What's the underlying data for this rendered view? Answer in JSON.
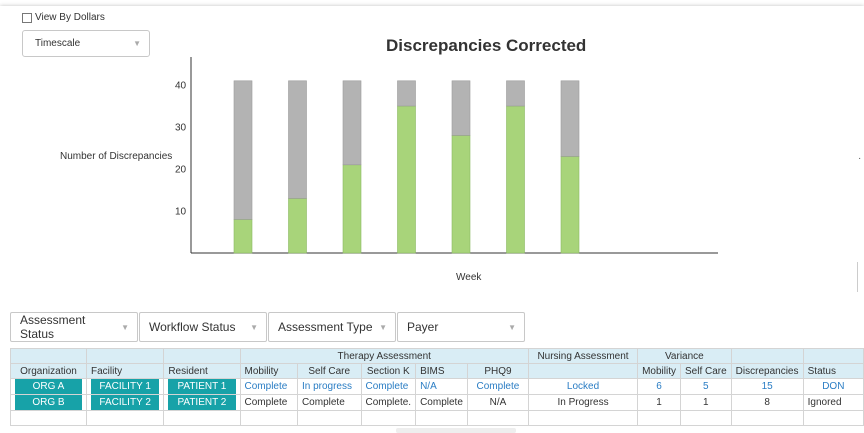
{
  "view_by_dollars": {
    "label": "View By Dollars",
    "checked": false
  },
  "timescale": {
    "label": "Timescale"
  },
  "chart_data": {
    "type": "bar",
    "stacked": true,
    "title": "Discrepancies Corrected",
    "ylabel": "Number of Discrepancies",
    "xlabel": "Week",
    "yticks": [
      "10",
      "20",
      "30",
      "40"
    ],
    "ylim": [
      0,
      48
    ],
    "grid": false,
    "series": [
      {
        "values": [
          8,
          13,
          21,
          35,
          28,
          35,
          23
        ],
        "color": "#a8d47a"
      },
      {
        "values": [
          33,
          28,
          20,
          6,
          13,
          6,
          18
        ],
        "color": "#b3b3b3"
      }
    ]
  },
  "filters": [
    "Assessment Status",
    "Workflow Status",
    "Assessment Type",
    "Payer"
  ],
  "table": {
    "group_headers": {
      "therapy": "Therapy Assessment",
      "nursing": "Nursing Assessment",
      "variance": "Variance"
    },
    "columns": [
      "Organization",
      "Facility",
      "Resident",
      "Mobility",
      "Self Care",
      "Section K",
      "BIMS",
      "PHQ9",
      "",
      "Mobility",
      "Self Care",
      "Discrepancies",
      "Status"
    ],
    "rows": [
      {
        "org": "ORG A",
        "facility": "FACILITY 1",
        "resident": "PATIENT 1",
        "mobility": "Complete",
        "self_care": "In progress",
        "section_k": "Complete",
        "bims": "N/A",
        "phq9": "Complete",
        "nursing": "Locked",
        "var_mobility": "6",
        "var_self_care": "5",
        "discrepancies": "15",
        "status": "DON"
      },
      {
        "org": "ORG B",
        "facility": "FACILITY 2",
        "resident": "PATIENT 2",
        "mobility": "Complete",
        "self_care": "Complete",
        "section_k": "Complete.",
        "bims": "Complete",
        "phq9": "N/A",
        "nursing": "In Progress",
        "var_mobility": "1",
        "var_self_care": "1",
        "discrepancies": "8",
        "status": "Ignored"
      }
    ]
  },
  "colors": {
    "accent": "#17a2a8",
    "header_bg": "#d9edf5",
    "link": "#2a7dc4"
  }
}
